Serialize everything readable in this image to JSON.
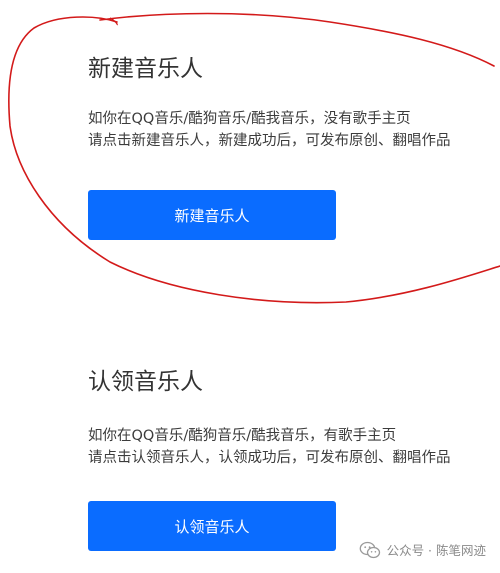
{
  "new_artist": {
    "title": "新建音乐人",
    "desc_line1": "如你在QQ音乐/酷狗音乐/酷我音乐，没有歌手主页",
    "desc_line2": "请点击新建音乐人，新建成功后，可发布原创、翻唱作品",
    "button_label": "新建音乐人"
  },
  "claim_artist": {
    "title": "认领音乐人",
    "desc_line1": "如你在QQ音乐/酷狗音乐/酷我音乐，有歌手主页",
    "desc_line2": "请点击认领音乐人，认领成功后，可发布原创、翻唱作品",
    "button_label": "认领音乐人"
  },
  "watermark": {
    "text": "公众号 · 陈笔网迹"
  },
  "colors": {
    "primary_button": "#0a6cff",
    "annotation_stroke": "#d31a1a"
  },
  "icons": {
    "watermark_icon": "wechat-icon"
  }
}
